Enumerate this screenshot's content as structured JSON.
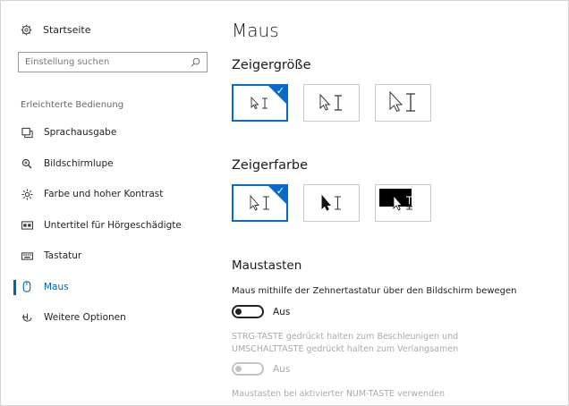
{
  "sidebar": {
    "home_label": "Startseite",
    "search_placeholder": "Einstellung suchen",
    "section_label": "Erleichterte Bedienung",
    "items": [
      {
        "label": "Sprachausgabe",
        "icon": "narrator-icon"
      },
      {
        "label": "Bildschirmlupe",
        "icon": "magnifier-icon"
      },
      {
        "label": "Farbe und hoher Kontrast",
        "icon": "brightness-icon"
      },
      {
        "label": "Untertitel für Hörgeschädigte",
        "icon": "closed-captions-icon"
      },
      {
        "label": "Tastatur",
        "icon": "keyboard-icon"
      },
      {
        "label": "Maus",
        "icon": "mouse-icon",
        "active": true
      },
      {
        "label": "Weitere Optionen",
        "icon": "more-options-icon"
      }
    ]
  },
  "main": {
    "title": "Maus",
    "pointer_size": {
      "heading": "Zeigergröße",
      "selected_index": 0
    },
    "pointer_color": {
      "heading": "Zeigerfarbe",
      "selected_index": 0
    },
    "mouse_keys": {
      "heading": "Maustasten",
      "description": "Maus mithilfe der Zehnertastatur über den Bildschirm bewegen",
      "toggle1_state": "Aus",
      "ctrl_description_line1": "STRG-TASTE gedrückt halten zum Beschleunigen und",
      "ctrl_description_line2": "UMSCHALTTASTE gedrückt halten zum Verlangsamen",
      "toggle2_state": "Aus",
      "numlock_description": "Maustasten bei aktivierter NUM-TASTE verwenden"
    }
  },
  "colors": {
    "accent": "#0063b1",
    "tile_selected": "#0a68c8"
  }
}
